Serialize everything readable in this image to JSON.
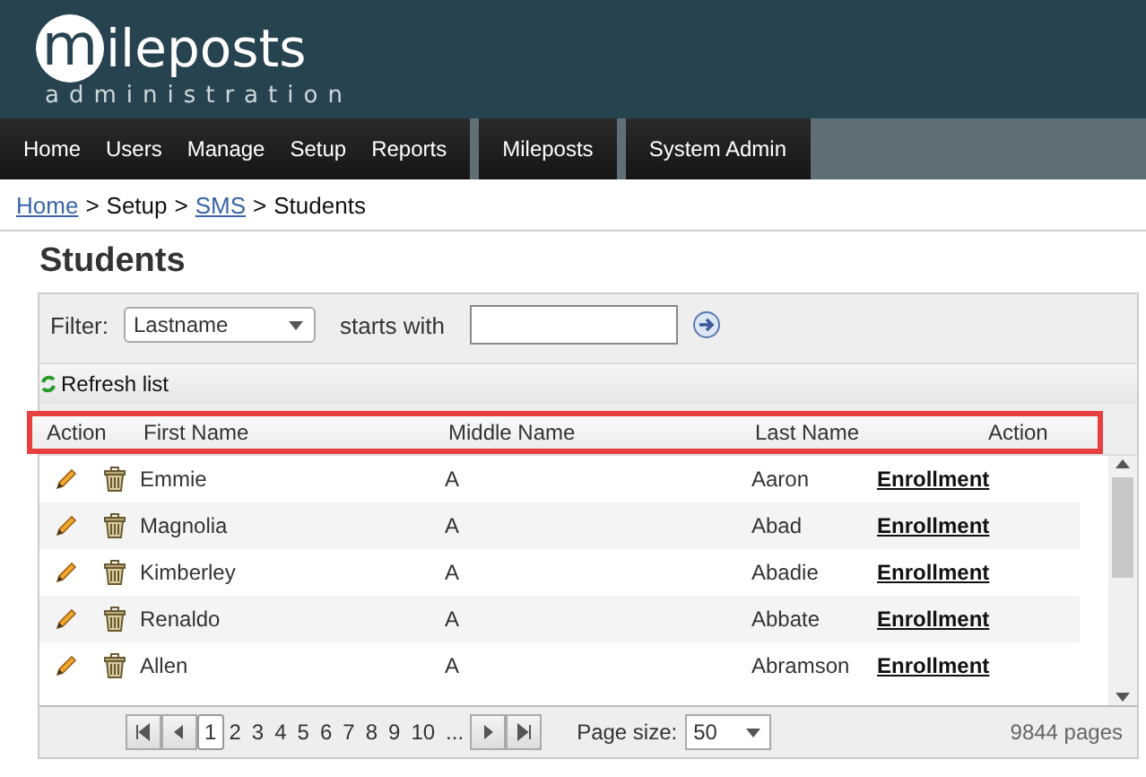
{
  "logo": {
    "letter": "m",
    "word": "ileposts",
    "subtitle": "administration"
  },
  "nav": [
    {
      "group": [
        {
          "label": "Home"
        },
        {
          "label": "Users"
        },
        {
          "label": "Manage"
        },
        {
          "label": "Setup"
        },
        {
          "label": "Reports"
        }
      ]
    },
    {
      "group": [
        {
          "label": "Mileposts"
        }
      ]
    },
    {
      "group": [
        {
          "label": "System Admin"
        }
      ]
    }
  ],
  "breadcrumb": [
    {
      "label": "Home",
      "link": true
    },
    {
      "label": "Setup",
      "link": false
    },
    {
      "label": "SMS",
      "link": true
    },
    {
      "label": "Students",
      "link": false
    }
  ],
  "breadcrumb_separator": ">",
  "title": "Students",
  "filter": {
    "label": "Filter:",
    "field": "Lastname",
    "condition": "starts with"
  },
  "refresh": "Refresh list",
  "columns": [
    "Action",
    "First Name",
    "Middle Name",
    "Last Name",
    "Action"
  ],
  "rows": [
    {
      "first": "Emmie",
      "middle": "A",
      "last": "Aaron",
      "action": "Enrollment"
    },
    {
      "first": "Magnolia",
      "middle": "A",
      "last": "Abad",
      "action": "Enrollment"
    },
    {
      "first": "Kimberley",
      "middle": "A",
      "last": "Abadie",
      "action": "Enrollment"
    },
    {
      "first": "Renaldo",
      "middle": "A",
      "last": "Abbate",
      "action": "Enrollment"
    },
    {
      "first": "Allen",
      "middle": "A",
      "last": "Abramson",
      "action": "Enrollment"
    }
  ],
  "pager": {
    "pages": [
      {
        "label": "1",
        "selected": true
      },
      {
        "label": "2",
        "selected": false
      },
      {
        "label": "3",
        "selected": false
      },
      {
        "label": "4",
        "selected": false
      },
      {
        "label": "5",
        "selected": false
      },
      {
        "label": "6",
        "selected": false
      },
      {
        "label": "7",
        "selected": false
      },
      {
        "label": "8",
        "selected": false
      },
      {
        "label": "9",
        "selected": false
      },
      {
        "label": "10",
        "selected": false
      },
      {
        "label": "...",
        "selected": false
      }
    ],
    "page_size_label": "Page size:",
    "page_size": "50",
    "total": "9844 pages"
  }
}
